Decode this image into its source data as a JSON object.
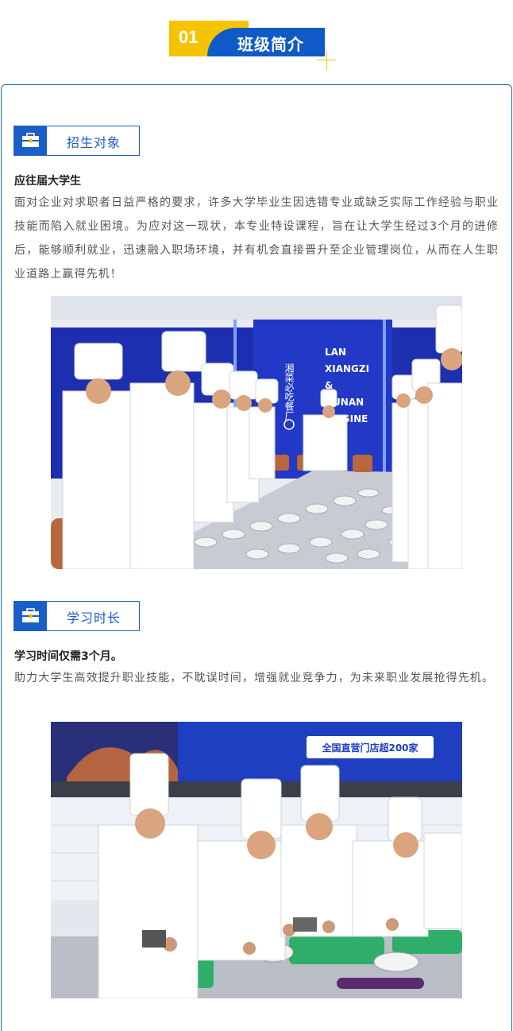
{
  "header": {
    "number": "01",
    "title": "班级简介"
  },
  "sections": [
    {
      "label": "招生对象",
      "icon": "briefcase-icon",
      "heading": "应往届大学生",
      "text": "面对企业对求职者日益严格的要求，许多大学毕业生因选错专业或缺乏实际工作经验与职业技能而陷入就业困境。为应对这一现状，本专业特设课程，旨在让大学生经过3个月的进修后，能够顺利就业，迅速融入职场环境，并有机会直接晋升至企业管理岗位，从而在人生职业道路上赢得先机！",
      "photo": {
        "wall_cn": "湘菜必吃餐厂",
        "wall_en_lines": [
          "LAN",
          "XIANGZI",
          "&",
          "HUNAN",
          "CUISINE"
        ]
      }
    },
    {
      "label": "学习时长",
      "icon": "briefcase-icon",
      "heading": "学习时间仅需3个月。",
      "text": "助力大学生高效提升职业技能，不耽误时间，增强就业竞争力，为未来职业发展抢得先机。",
      "photo": {
        "banner_text": "全国直营门店超200家"
      }
    }
  ],
  "colors": {
    "brand_blue": "#0f5ac7",
    "accent_yellow": "#f5c400",
    "panel_border": "#1e6ea5"
  }
}
